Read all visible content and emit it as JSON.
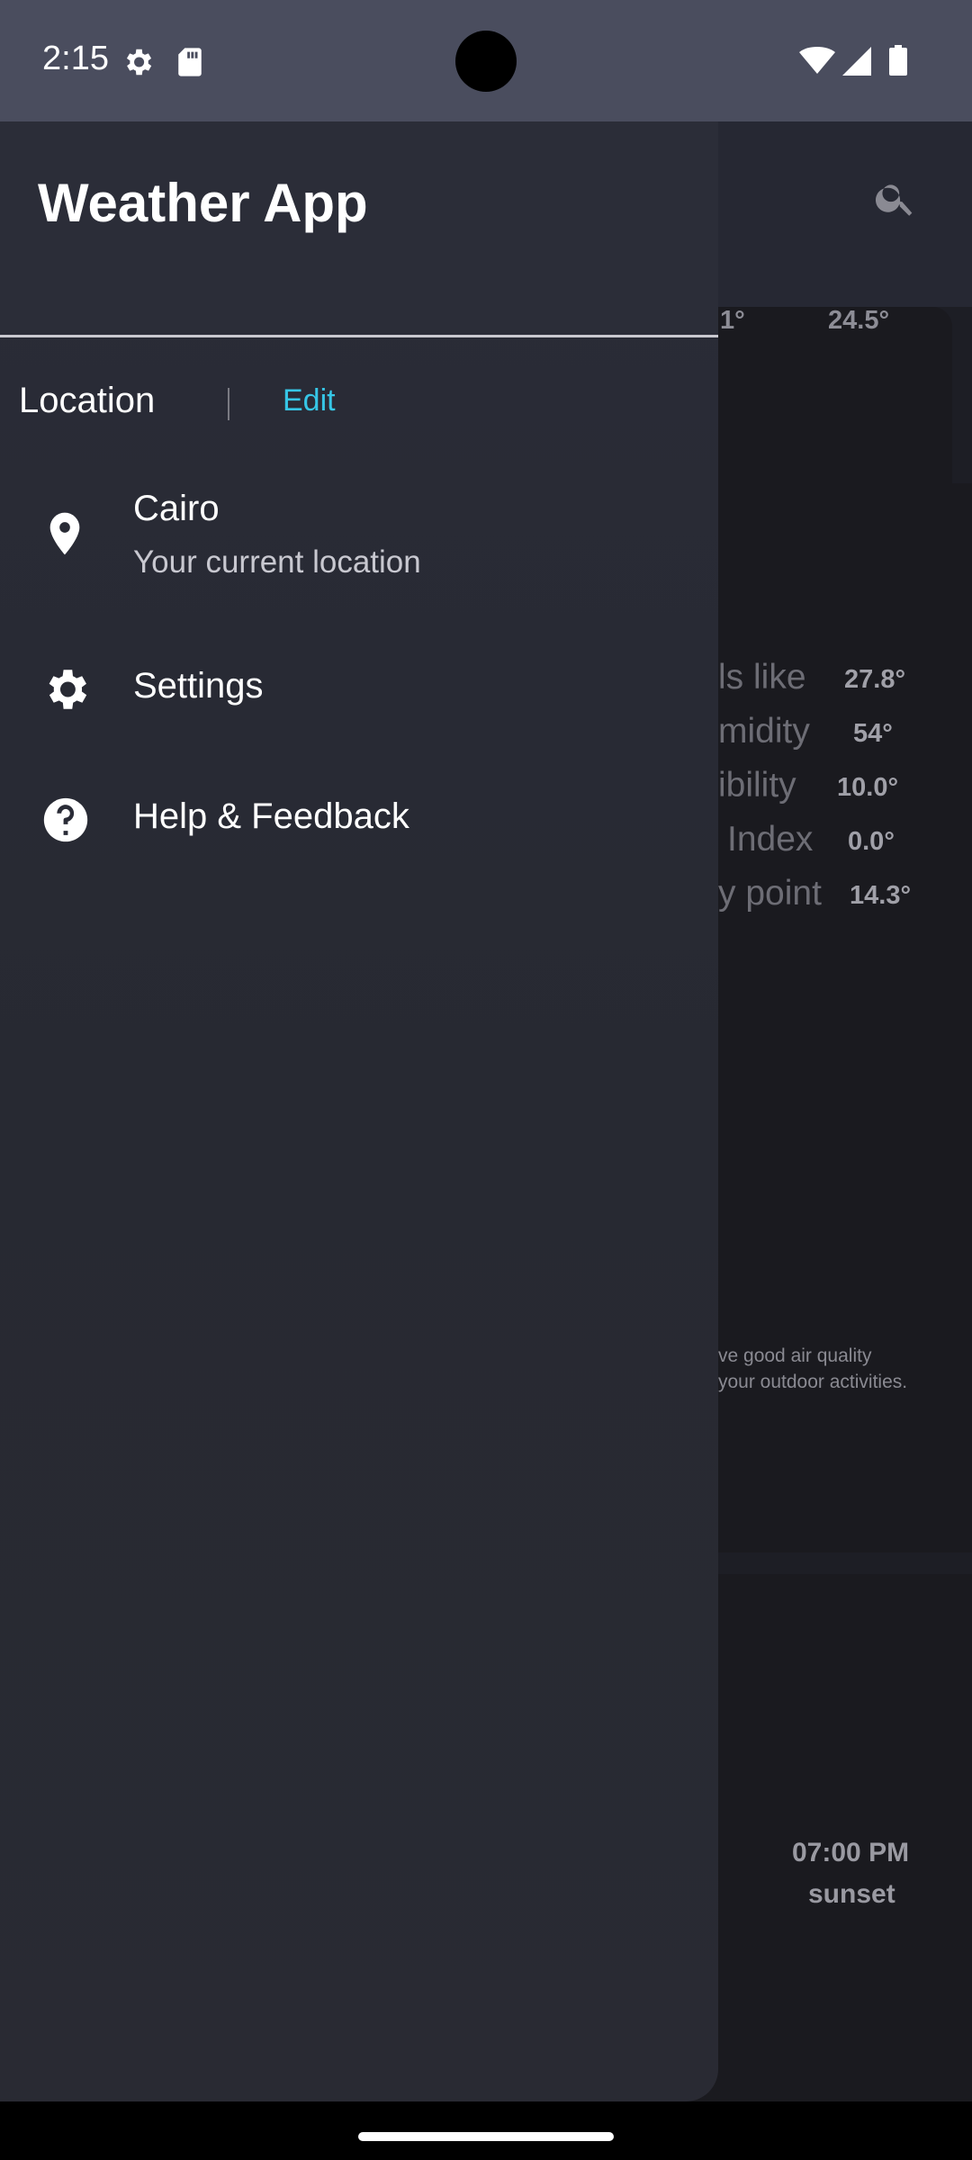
{
  "status_bar": {
    "time": "2:15"
  },
  "background": {
    "temps": [
      "1°",
      "24.5°"
    ],
    "details": [
      {
        "label": "ls like",
        "value": "27.8°"
      },
      {
        "label": "midity",
        "value": "54°"
      },
      {
        "label": "ibility",
        "value": "10.0°"
      },
      {
        "label": "Index",
        "value": "0.0°"
      },
      {
        "label": "y point",
        "value": "14.3°"
      }
    ],
    "air_quality": [
      "ve good air quality",
      "your outdoor activities."
    ],
    "sunset_time": "07:00 PM",
    "sunset_label": "sunset"
  },
  "drawer": {
    "title": "Weather App",
    "location_label": "Location",
    "edit_label": "Edit",
    "items": [
      {
        "title": "Cairo",
        "subtitle": "Your current location"
      },
      {
        "title": "Settings"
      },
      {
        "title": "Help & Feedback"
      }
    ]
  },
  "colors": {
    "accent": "#36c6e6",
    "drawer": "#2a2c37",
    "status_bar": "#4a4d5e"
  }
}
